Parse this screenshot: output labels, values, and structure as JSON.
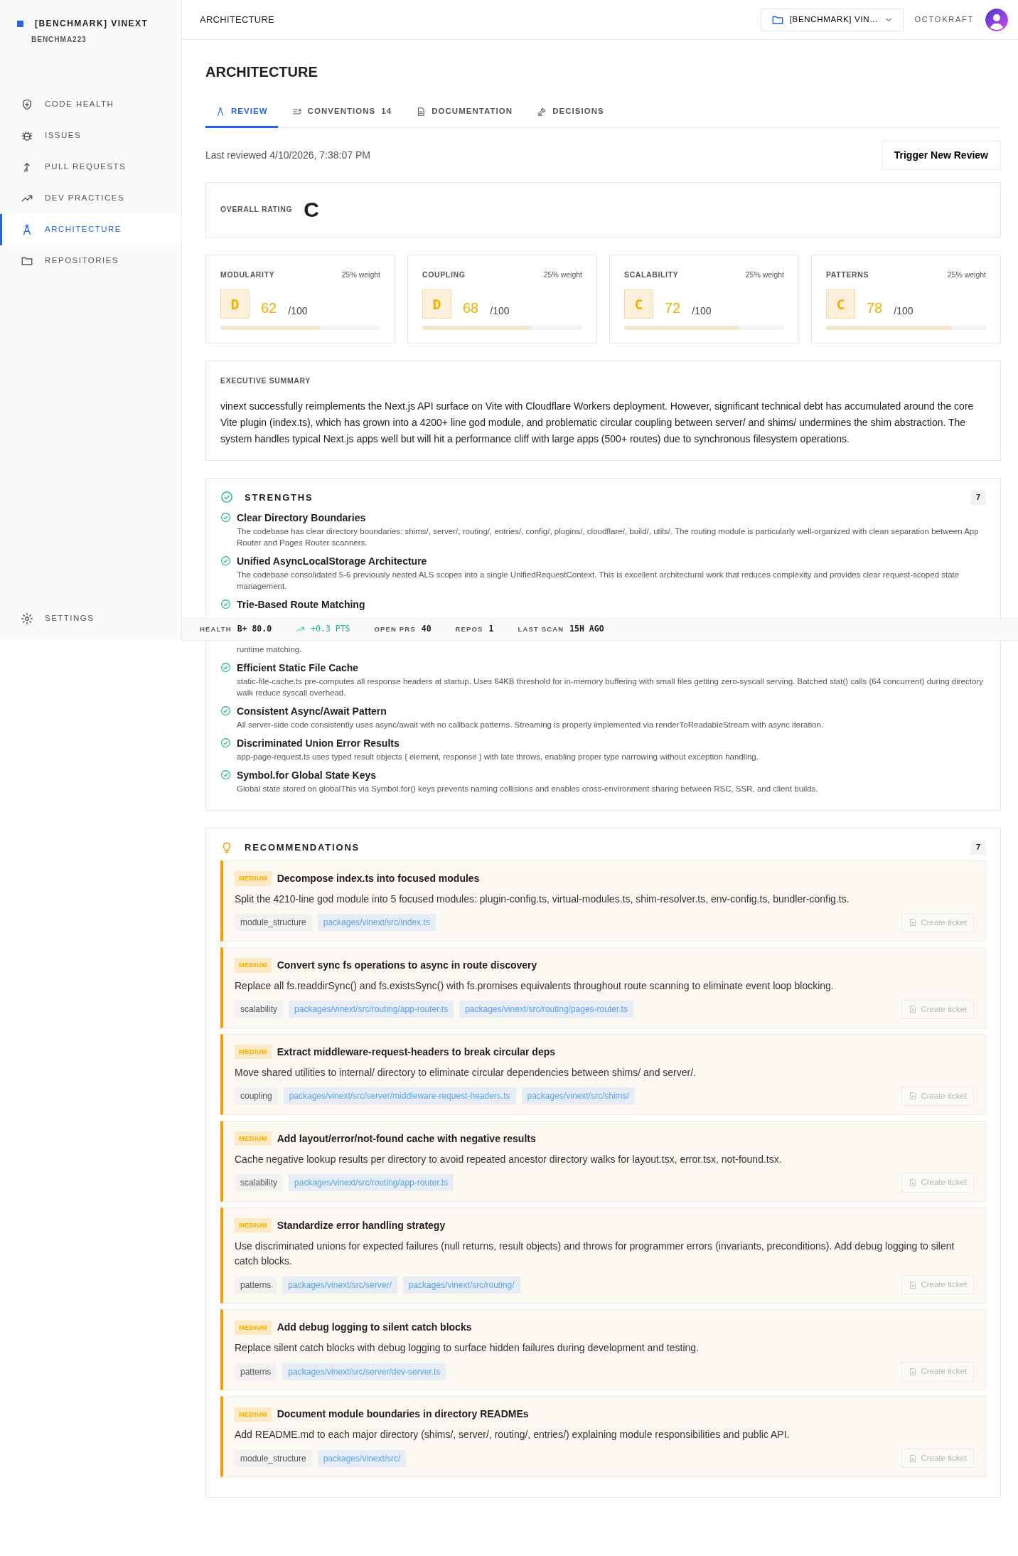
{
  "sidebar": {
    "brand": "[BENCHMARK] VINEXT",
    "org": "BENCHMA223",
    "items": [
      {
        "label": "CODE HEALTH",
        "selected": false
      },
      {
        "label": "ISSUES",
        "selected": false
      },
      {
        "label": "PULL REQUESTS",
        "selected": false
      },
      {
        "label": "DEV PRACTICES",
        "selected": false
      },
      {
        "label": "ARCHITECTURE",
        "selected": true
      },
      {
        "label": "REPOSITORIES",
        "selected": false
      }
    ],
    "settings": "SETTINGS"
  },
  "header": {
    "breadcrumb": "ARCHITECTURE",
    "repo_selector": "[BENCHMARK] VIN…",
    "user": "OCTOKRAFT"
  },
  "page": {
    "title": "ARCHITECTURE",
    "tabs": [
      {
        "label": "REVIEW",
        "selected": true
      },
      {
        "label": "CONVENTIONS",
        "count": "14",
        "selected": false
      },
      {
        "label": "DOCUMENTATION",
        "selected": false
      },
      {
        "label": "DECISIONS",
        "selected": false
      }
    ],
    "last_reviewed": "Last reviewed 4/10/2026, 7:38:07 PM",
    "trigger_button": "Trigger New Review"
  },
  "overall": {
    "label": "OVERALL RATING",
    "grade": "C"
  },
  "scores": [
    {
      "name": "MODULARITY",
      "weight": "25% weight",
      "grade": "D",
      "score": "62",
      "max": "/100",
      "level": 0.62
    },
    {
      "name": "COUPLING",
      "weight": "25% weight",
      "grade": "D",
      "score": "68",
      "max": "/100",
      "level": 0.68
    },
    {
      "name": "SCALABILITY",
      "weight": "25% weight",
      "grade": "C",
      "score": "72",
      "max": "/100",
      "level": 0.72
    },
    {
      "name": "PATTERNS",
      "weight": "25% weight",
      "grade": "C",
      "score": "78",
      "max": "/100",
      "level": 0.78
    }
  ],
  "summary": {
    "title": "EXECUTIVE SUMMARY",
    "text": "vinext successfully reimplements the Next.js API surface on Vite with Cloudflare Workers deployment. However, significant technical debt has accumulated around the core Vite plugin (index.ts), which has grown into a 4200+ line god module, and problematic circular coupling between server/ and shims/ undermines the shim abstraction. The system handles typical Next.js apps well but will hit a performance cliff with large apps (500+ routes) due to synchronous filesystem operations."
  },
  "strengths": {
    "title": "STRENGTHS",
    "count": "7",
    "items": [
      {
        "title": "Clear Directory Boundaries",
        "text": "The codebase has clear directory boundaries: shims/, server/, routing/, entries/, config/, plugins/, cloudflare/, build/, utils/. The routing module is particularly well-organized with clean separation between App Router and Pages Router scanners."
      },
      {
        "title": "Unified AsyncLocalStorage Architecture",
        "text": "The codebase consolidated 5-6 previously nested ALS scopes into a single UnifiedRequestContext. This is excellent architectural work that reduces complexity and provides clear request-scoped state management."
      },
      {
        "title": "Trie-Based Route Matching",
        "text": "runtime matching."
      },
      {
        "title": "Efficient Static File Cache",
        "text": "static-file-cache.ts pre-computes all response headers at startup. Uses 64KB threshold for in-memory buffering with small files getting zero-syscall serving. Batched stat() calls (64 concurrent) during directory walk reduce syscall overhead."
      },
      {
        "title": "Consistent Async/Await Pattern",
        "text": "All server-side code consistently uses async/await with no callback patterns. Streaming is properly implemented via renderToReadableStream with async iteration."
      },
      {
        "title": "Discriminated Union Error Results",
        "text": "app-page-request.ts uses typed result objects { element, response } with late throws, enabling proper type narrowing without exception handling."
      },
      {
        "title": "Symbol.for Global State Keys",
        "text": "Global state stored on globalThis via Symbol.for() keys prevents naming collisions and enables cross-environment sharing between RSC, SSR, and client builds."
      }
    ]
  },
  "status_bar": [
    {
      "kind": "stat",
      "label": "HEALTH",
      "value": "B+ 80.0"
    },
    {
      "kind": "trend",
      "value": "+0.3 PTS"
    },
    {
      "kind": "stat",
      "label": "OPEN PRS",
      "value": "40"
    },
    {
      "kind": "stat",
      "label": "REPOS",
      "value": "1"
    },
    {
      "kind": "stat",
      "label": "LAST SCAN",
      "value": "15H AGO"
    }
  ],
  "recommendations": {
    "title": "RECOMMENDATIONS",
    "count": "7",
    "items": [
      {
        "severity": "MEDIUM",
        "title": "Decompose index.ts into focused modules",
        "text": "Split the 4210-line god module into 5 focused modules: plugin-config.ts, virtual-modules.ts, shim-resolver.ts, env-config.ts, bundler-config.ts.",
        "category": "module_structure",
        "files": [
          "packages/vinext/src/index.ts"
        ],
        "action": "Create ticket",
        "action_disabled": true
      },
      {
        "severity": "MEDIUM",
        "title": "Convert sync fs operations to async in route discovery",
        "text": "Replace all fs.readdirSync() and fs.existsSync() with fs.promises equivalents throughout route scanning to eliminate event loop blocking.",
        "category": "scalability",
        "files": [
          "packages/vinext/src/routing/app-router.ts",
          "packages/vinext/src/routing/pages-router.ts"
        ],
        "action": "Create ticket",
        "action_disabled": true
      },
      {
        "severity": "MEDIUM",
        "title": "Extract middleware-request-headers to break circular deps",
        "text": "Move shared utilities to internal/ directory to eliminate circular dependencies between shims/ and server/.",
        "category": "coupling",
        "files": [
          "packages/vinext/src/server/middleware-request-headers.ts",
          "packages/vinext/src/shims/"
        ],
        "action": "Create ticket",
        "action_disabled": true
      },
      {
        "severity": "MEDIUM",
        "title": "Add layout/error/not-found cache with negative results",
        "text": "Cache negative lookup results per directory to avoid repeated ancestor directory walks for layout.tsx, error.tsx, not-found.tsx.",
        "category": "scalability",
        "files": [
          "packages/vinext/src/routing/app-router.ts"
        ],
        "action": "Create ticket",
        "action_disabled": true
      },
      {
        "severity": "MEDIUM",
        "title": "Standardize error handling strategy",
        "text": "Use discriminated unions for expected failures (null returns, result objects) and throws for programmer errors (invariants, preconditions). Add debug logging to silent catch blocks.",
        "category": "patterns",
        "files": [
          "packages/vinext/src/server/",
          "packages/vinext/src/routing/"
        ],
        "action": "Create ticket",
        "action_disabled": true
      },
      {
        "severity": "MEDIUM",
        "title": "Add debug logging to silent catch blocks",
        "text": "Replace silent catch blocks with debug logging to surface hidden failures during development and testing.",
        "category": "patterns",
        "files": [
          "packages/vinext/src/server/dev-server.ts"
        ],
        "action": "Create ticket",
        "action_disabled": true
      },
      {
        "severity": "MEDIUM",
        "title": "Document module boundaries in directory READMEs",
        "text": "Add README.md to each major directory (shims/, server/, routing/, entries/) explaining module responsibilities and public API.",
        "category": "module_structure",
        "files": [
          "packages/vinext/src/"
        ],
        "action": "Create ticket",
        "action_disabled": true
      }
    ]
  }
}
